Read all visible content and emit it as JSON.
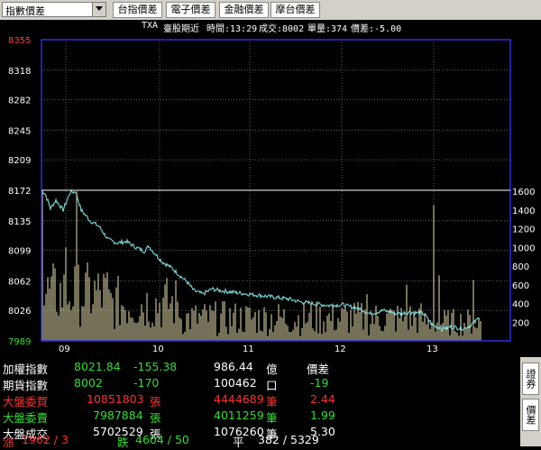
{
  "toolbar": {
    "dropdown_value": "指數價差",
    "buttons": [
      "台指價差",
      "電子價差",
      "金融價差",
      "摩台價差"
    ]
  },
  "info_line": {
    "symbol": "TXA",
    "name": "臺股期近",
    "time": "時間:13:29",
    "volume": "成交:8002",
    "qty": "單量:374",
    "spread": "價差:-5.00"
  },
  "chart_data": {
    "type": "line",
    "y_ticks": [
      "8355",
      "8318",
      "8282",
      "8245",
      "8209",
      "8172",
      "8135",
      "8099",
      "8062",
      "8026",
      "7989"
    ],
    "ylim": [
      7989,
      8355
    ],
    "volume_ticks": [
      "1600",
      "1400",
      "1200",
      "1000",
      "800",
      "600",
      "400",
      "200"
    ],
    "volume_lim": [
      0,
      1600
    ],
    "x_ticks": [
      "09",
      "10",
      "11",
      "12",
      "13"
    ],
    "reference_level": 8172,
    "colors": {
      "price": "#7fd6d6",
      "volume": "#e8e2b0",
      "grid": "#5a5a5a",
      "border": "#2e2ee0",
      "reference": "#ffffff"
    }
  },
  "panel": {
    "rows": [
      {
        "label": "加權指數",
        "c1": "8021.84",
        "c2": "-155.38",
        "c3": "986.44",
        "u3": "億",
        "c4": "價差",
        "color": "#ffffff"
      },
      {
        "label": "期貨指數",
        "c1": "8002",
        "c2": "-170",
        "c3": "100462",
        "u3": "口",
        "c4": "-19",
        "color": "#ffffff"
      },
      {
        "label": "大盤委買",
        "c1": "10851803",
        "u1": "張",
        "c3": "4444689",
        "u3": "筆",
        "c4": "2.44",
        "color": "#ff3030"
      },
      {
        "label": "大盤委賣",
        "c1": "7987884",
        "u1": "張",
        "c3": "4011259",
        "u3": "筆",
        "c4": "1.99",
        "color": "#33dd33"
      },
      {
        "label": "大盤成交",
        "c1": "5702529",
        "u1": "張",
        "c3": "1076260",
        "u3": "筆",
        "c4": "5.30",
        "color": "#ffffff"
      }
    ],
    "bottom": {
      "up_label": "漲",
      "up_value": "1962 / 3",
      "down_label": "跌",
      "down_value": "4604 / 50",
      "flat_label": "平",
      "flat_value": "382 / 5329"
    }
  },
  "right_tabs": [
    "證券",
    "價差"
  ]
}
